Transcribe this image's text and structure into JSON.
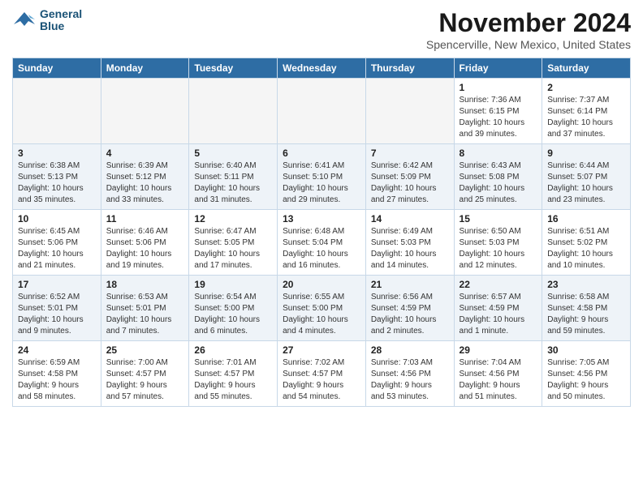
{
  "logo": {
    "line1": "General",
    "line2": "Blue"
  },
  "title": "November 2024",
  "subtitle": "Spencerville, New Mexico, United States",
  "days_of_week": [
    "Sunday",
    "Monday",
    "Tuesday",
    "Wednesday",
    "Thursday",
    "Friday",
    "Saturday"
  ],
  "weeks": [
    [
      {
        "day": "",
        "info": "",
        "empty": true
      },
      {
        "day": "",
        "info": "",
        "empty": true
      },
      {
        "day": "",
        "info": "",
        "empty": true
      },
      {
        "day": "",
        "info": "",
        "empty": true
      },
      {
        "day": "",
        "info": "",
        "empty": true
      },
      {
        "day": "1",
        "info": "Sunrise: 7:36 AM\nSunset: 6:15 PM\nDaylight: 10 hours\nand 39 minutes."
      },
      {
        "day": "2",
        "info": "Sunrise: 7:37 AM\nSunset: 6:14 PM\nDaylight: 10 hours\nand 37 minutes."
      }
    ],
    [
      {
        "day": "3",
        "info": "Sunrise: 6:38 AM\nSunset: 5:13 PM\nDaylight: 10 hours\nand 35 minutes."
      },
      {
        "day": "4",
        "info": "Sunrise: 6:39 AM\nSunset: 5:12 PM\nDaylight: 10 hours\nand 33 minutes."
      },
      {
        "day": "5",
        "info": "Sunrise: 6:40 AM\nSunset: 5:11 PM\nDaylight: 10 hours\nand 31 minutes."
      },
      {
        "day": "6",
        "info": "Sunrise: 6:41 AM\nSunset: 5:10 PM\nDaylight: 10 hours\nand 29 minutes."
      },
      {
        "day": "7",
        "info": "Sunrise: 6:42 AM\nSunset: 5:09 PM\nDaylight: 10 hours\nand 27 minutes."
      },
      {
        "day": "8",
        "info": "Sunrise: 6:43 AM\nSunset: 5:08 PM\nDaylight: 10 hours\nand 25 minutes."
      },
      {
        "day": "9",
        "info": "Sunrise: 6:44 AM\nSunset: 5:07 PM\nDaylight: 10 hours\nand 23 minutes."
      }
    ],
    [
      {
        "day": "10",
        "info": "Sunrise: 6:45 AM\nSunset: 5:06 PM\nDaylight: 10 hours\nand 21 minutes."
      },
      {
        "day": "11",
        "info": "Sunrise: 6:46 AM\nSunset: 5:06 PM\nDaylight: 10 hours\nand 19 minutes."
      },
      {
        "day": "12",
        "info": "Sunrise: 6:47 AM\nSunset: 5:05 PM\nDaylight: 10 hours\nand 17 minutes."
      },
      {
        "day": "13",
        "info": "Sunrise: 6:48 AM\nSunset: 5:04 PM\nDaylight: 10 hours\nand 16 minutes."
      },
      {
        "day": "14",
        "info": "Sunrise: 6:49 AM\nSunset: 5:03 PM\nDaylight: 10 hours\nand 14 minutes."
      },
      {
        "day": "15",
        "info": "Sunrise: 6:50 AM\nSunset: 5:03 PM\nDaylight: 10 hours\nand 12 minutes."
      },
      {
        "day": "16",
        "info": "Sunrise: 6:51 AM\nSunset: 5:02 PM\nDaylight: 10 hours\nand 10 minutes."
      }
    ],
    [
      {
        "day": "17",
        "info": "Sunrise: 6:52 AM\nSunset: 5:01 PM\nDaylight: 10 hours\nand 9 minutes."
      },
      {
        "day": "18",
        "info": "Sunrise: 6:53 AM\nSunset: 5:01 PM\nDaylight: 10 hours\nand 7 minutes."
      },
      {
        "day": "19",
        "info": "Sunrise: 6:54 AM\nSunset: 5:00 PM\nDaylight: 10 hours\nand 6 minutes."
      },
      {
        "day": "20",
        "info": "Sunrise: 6:55 AM\nSunset: 5:00 PM\nDaylight: 10 hours\nand 4 minutes."
      },
      {
        "day": "21",
        "info": "Sunrise: 6:56 AM\nSunset: 4:59 PM\nDaylight: 10 hours\nand 2 minutes."
      },
      {
        "day": "22",
        "info": "Sunrise: 6:57 AM\nSunset: 4:59 PM\nDaylight: 10 hours\nand 1 minute."
      },
      {
        "day": "23",
        "info": "Sunrise: 6:58 AM\nSunset: 4:58 PM\nDaylight: 9 hours\nand 59 minutes."
      }
    ],
    [
      {
        "day": "24",
        "info": "Sunrise: 6:59 AM\nSunset: 4:58 PM\nDaylight: 9 hours\nand 58 minutes."
      },
      {
        "day": "25",
        "info": "Sunrise: 7:00 AM\nSunset: 4:57 PM\nDaylight: 9 hours\nand 57 minutes."
      },
      {
        "day": "26",
        "info": "Sunrise: 7:01 AM\nSunset: 4:57 PM\nDaylight: 9 hours\nand 55 minutes."
      },
      {
        "day": "27",
        "info": "Sunrise: 7:02 AM\nSunset: 4:57 PM\nDaylight: 9 hours\nand 54 minutes."
      },
      {
        "day": "28",
        "info": "Sunrise: 7:03 AM\nSunset: 4:56 PM\nDaylight: 9 hours\nand 53 minutes."
      },
      {
        "day": "29",
        "info": "Sunrise: 7:04 AM\nSunset: 4:56 PM\nDaylight: 9 hours\nand 51 minutes."
      },
      {
        "day": "30",
        "info": "Sunrise: 7:05 AM\nSunset: 4:56 PM\nDaylight: 9 hours\nand 50 minutes."
      }
    ]
  ]
}
